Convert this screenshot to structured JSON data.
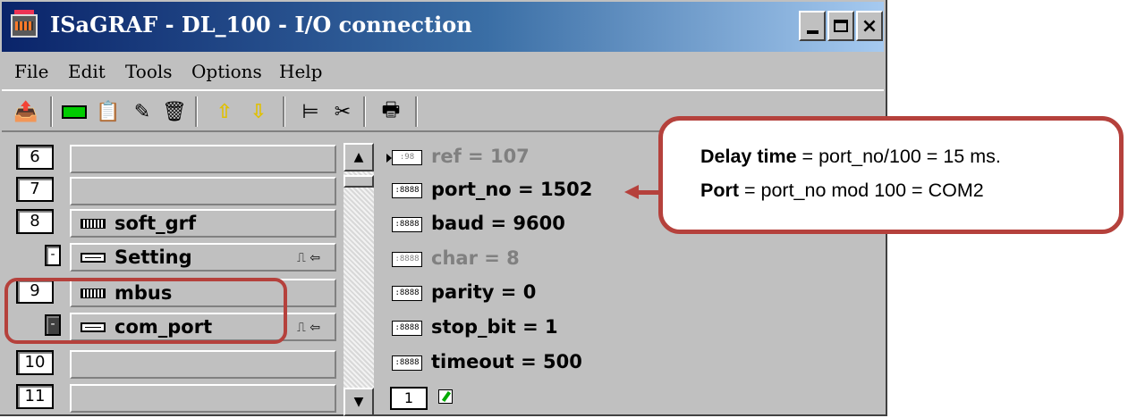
{
  "window": {
    "title": "ISaGRAF - DL_100 - I/O connection",
    "min_glyph": "_",
    "close_glyph": "×"
  },
  "menu": [
    "File",
    "Edit",
    "Tools",
    "Options",
    "Help"
  ],
  "toolbar_icons": [
    "open-board-icon",
    "board-icon",
    "copy-board-icon",
    "edit-board-icon",
    "delete-icon",
    "up-arrow-icon",
    "down-arrow-icon",
    "tree-icon",
    "cut-icon",
    "print-icon"
  ],
  "rows": [
    {
      "num": "6",
      "label": ""
    },
    {
      "num": "7",
      "label": ""
    },
    {
      "num": "8",
      "label": "soft_grf"
    },
    {
      "num": "-",
      "label": "Setting",
      "signal": "⎍ ⇦"
    },
    {
      "num": "9",
      "label": "mbus"
    },
    {
      "num": "-",
      "label": "com_port",
      "signal": "⎍ ⇦"
    },
    {
      "num": "10",
      "label": ""
    },
    {
      "num": "11",
      "label": ""
    }
  ],
  "params": [
    {
      "box": ":98",
      "text": "ref = 107"
    },
    {
      "box": ":8888",
      "text": "port_no = 1502"
    },
    {
      "box": ":8888",
      "text": "baud = 9600"
    },
    {
      "box": ":8888",
      "text": "char = 8"
    },
    {
      "box": ":8888",
      "text": "parity = 0"
    },
    {
      "box": ":8888",
      "text": "stop_bit = 1"
    },
    {
      "box": ":8888",
      "text": "timeout = 500"
    }
  ],
  "bottom_box": "1",
  "scroll": {
    "up": "▲",
    "down": "▼"
  },
  "callout": {
    "line1_bold": "Delay time",
    "line1_rest": " = port_no/100 = 15 ms.",
    "line2_bold": "Port",
    "line2_rest": " = port_no mod 100 = COM2"
  },
  "colors": {
    "annotation": "#b5413c",
    "title_bar": "#0a246a"
  }
}
